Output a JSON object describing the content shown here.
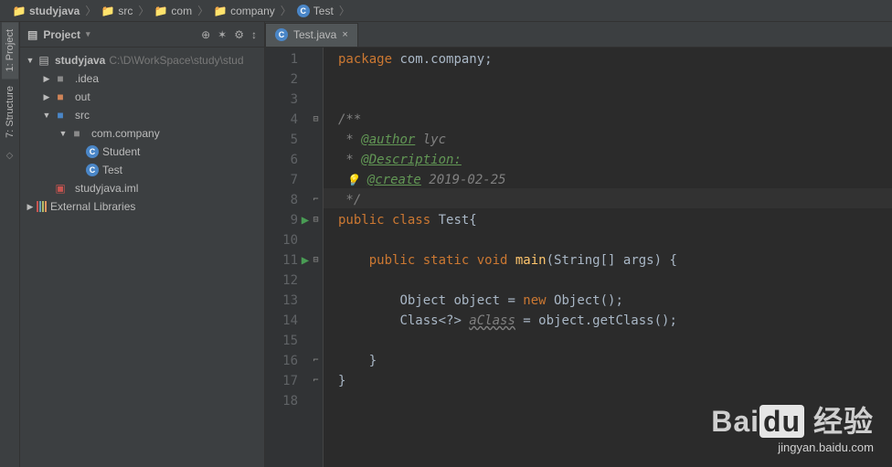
{
  "breadcrumb": [
    {
      "icon": "folder",
      "label": "studyjava"
    },
    {
      "icon": "folder",
      "label": "src"
    },
    {
      "icon": "folder",
      "label": "com"
    },
    {
      "icon": "folder",
      "label": "company"
    },
    {
      "icon": "class",
      "label": "Test"
    }
  ],
  "left_tabs": [
    {
      "label": "1: Project",
      "active": true
    },
    {
      "label": "7: Structure",
      "active": false
    }
  ],
  "sidebar": {
    "title": "Project",
    "tools": [
      "⊕",
      "✶",
      "⚙",
      "↕"
    ],
    "tree": {
      "root": {
        "name": "studyjava",
        "path": "C:\\D\\WorkSpace\\study\\stud"
      },
      "items": [
        {
          "depth": 1,
          "arrow": "▶",
          "icon": "folder",
          "label": ".idea"
        },
        {
          "depth": 1,
          "arrow": "▶",
          "icon": "folder-orange",
          "label": "out"
        },
        {
          "depth": 1,
          "arrow": "▼",
          "icon": "folder-blue",
          "label": "src"
        },
        {
          "depth": 2,
          "arrow": "▼",
          "icon": "folder",
          "label": "com.company"
        },
        {
          "depth": 3,
          "arrow": "",
          "icon": "class",
          "label": "Student"
        },
        {
          "depth": 3,
          "arrow": "",
          "icon": "class",
          "label": "Test"
        },
        {
          "depth": 1,
          "arrow": "",
          "icon": "iml",
          "label": "studyjava.iml"
        }
      ],
      "external": "External Libraries"
    }
  },
  "tab": {
    "label": "Test.java"
  },
  "code": {
    "lines": [
      {
        "n": 1,
        "html": "<span class='kw'>package</span> <span class='plain'>com.company;</span>"
      },
      {
        "n": 2,
        "html": ""
      },
      {
        "n": 3,
        "html": ""
      },
      {
        "n": 4,
        "html": "<span class='comment'>/**</span>",
        "fold": "⊟"
      },
      {
        "n": 5,
        "html": "<span class='comment'> * </span><span class='doctag'>@author</span> <span class='docval'>lyc</span>"
      },
      {
        "n": 6,
        "html": "<span class='comment'> * </span><span class='doctag'>@Description:</span>"
      },
      {
        "n": 7,
        "html": "<span class='comment'> <span class='bulb'>💡</span> </span><span class='doctag'>@create</span> <span class='docval'>2019-02-25</span>"
      },
      {
        "n": 8,
        "html": "<span class='comment'> */</span>",
        "fold": "⌐"
      },
      {
        "n": 9,
        "html": "<span class='kw'>public class</span> <span class='plain'>Test{</span>",
        "run": true,
        "fold": "⊟"
      },
      {
        "n": 10,
        "html": ""
      },
      {
        "n": 11,
        "html": "    <span class='kw'>public static void</span> <span class='method'>main</span><span class='bracket'>(</span><span class='plain'>String[] args</span><span class='bracket'>)</span> <span class='bracket'>{</span>",
        "run": true,
        "fold": "⊟"
      },
      {
        "n": 12,
        "html": ""
      },
      {
        "n": 13,
        "html": "        <span class='plain'>Object object = </span><span class='kw'>new</span> <span class='plain'>Object();</span>"
      },
      {
        "n": 14,
        "html": "        <span class='plain'>Class&lt;?&gt; </span><span class='var-warn'>aClass</span><span class='plain'> = object.getClass();</span>"
      },
      {
        "n": 15,
        "html": ""
      },
      {
        "n": 16,
        "html": "    <span class='bracket'>}</span>",
        "fold": "⌐"
      },
      {
        "n": 17,
        "html": "<span class='bracket'>}</span>",
        "fold": "⌐"
      },
      {
        "n": 18,
        "html": ""
      }
    ]
  },
  "watermark": {
    "brand": "Bai",
    "du": "du",
    "cn": "经验",
    "url": "jingyan.baidu.com"
  }
}
